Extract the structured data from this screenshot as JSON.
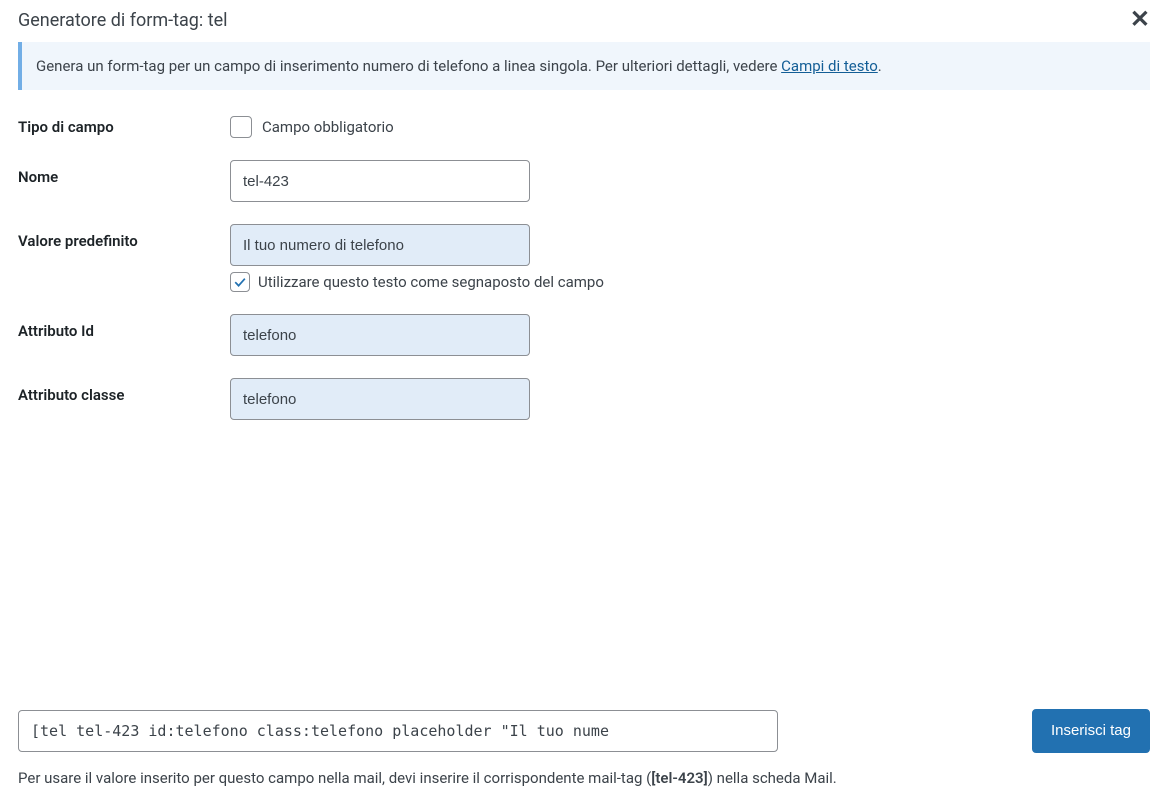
{
  "dialog": {
    "title": "Generatore di form-tag: tel",
    "info_text_before": "Genera un form-tag per un campo di inserimento numero di telefono a linea singola. Per ulteriori dettagli, vedere ",
    "info_link": "Campi di testo",
    "info_text_after": "."
  },
  "form": {
    "field_type": {
      "label": "Tipo di campo",
      "required_label": "Campo obbligatorio",
      "required_checked": false
    },
    "name": {
      "label": "Nome",
      "value": "tel-423"
    },
    "default_value": {
      "label": "Valore predefinito",
      "value": "Il tuo numero di telefono",
      "placeholder_label": "Utilizzare questo testo come segnaposto del campo",
      "placeholder_checked": true
    },
    "id_attr": {
      "label": "Attributo Id",
      "value": "telefono"
    },
    "class_attr": {
      "label": "Attributo classe",
      "value": "telefono"
    }
  },
  "footer": {
    "tag_value": "[tel tel-423 id:telefono class:telefono placeholder \"Il tuo nume",
    "insert_button": "Inserisci tag",
    "hint_before": "Per usare il valore inserito per questo campo nella mail, devi inserire il corrispondente mail-tag (",
    "hint_strong": "[tel-423]",
    "hint_after": ") nella scheda Mail."
  }
}
